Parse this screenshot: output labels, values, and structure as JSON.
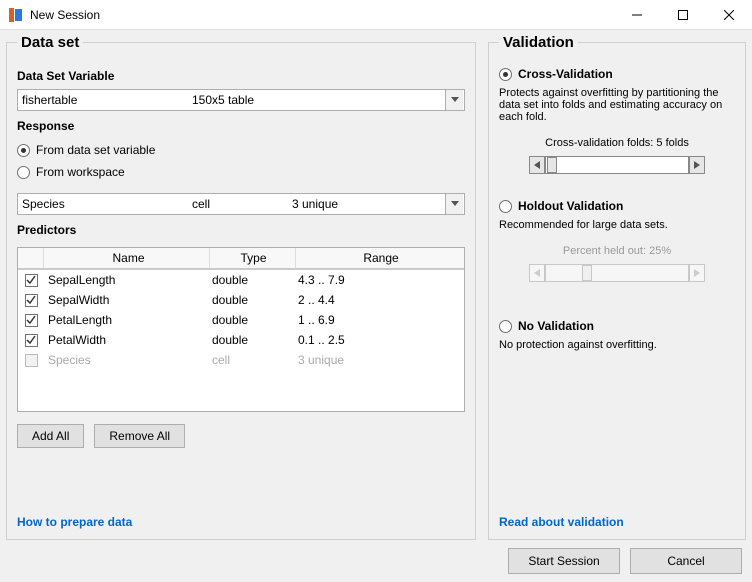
{
  "window": {
    "title": "New Session"
  },
  "dataset": {
    "legend": "Data set",
    "var_label": "Data Set Variable",
    "var_name": "fishertable",
    "var_size": "150x5 table",
    "response_label": "Response",
    "from_dataset": "From data set variable",
    "from_workspace": "From workspace",
    "resp_name": "Species",
    "resp_type": "cell",
    "resp_range": "3 unique",
    "predictors_label": "Predictors",
    "headers": {
      "name": "Name",
      "type": "Type",
      "range": "Range"
    },
    "rows": [
      {
        "checked": true,
        "name": "SepalLength",
        "type": "double",
        "range": "4.3 .. 7.9"
      },
      {
        "checked": true,
        "name": "SepalWidth",
        "type": "double",
        "range": "2 .. 4.4"
      },
      {
        "checked": true,
        "name": "PetalLength",
        "type": "double",
        "range": "1 .. 6.9"
      },
      {
        "checked": true,
        "name": "PetalWidth",
        "type": "double",
        "range": "0.1 .. 2.5"
      },
      {
        "checked": false,
        "name": "Species",
        "type": "cell",
        "range": "3 unique",
        "disabled": true
      }
    ],
    "add_all": "Add All",
    "remove_all": "Remove All",
    "prepare_link": "How to prepare data"
  },
  "validation": {
    "legend": "Validation",
    "cross": {
      "label": "Cross-Validation",
      "desc": "Protects against overfitting by partitioning the data set into folds and estimating accuracy on each fold.",
      "folds_label": "Cross-validation folds: 5 folds"
    },
    "holdout": {
      "label": "Holdout Validation",
      "desc": "Recommended for large data sets.",
      "percent_label": "Percent held out: 25%"
    },
    "none": {
      "label": "No Validation",
      "desc": "No protection against overfitting."
    },
    "read_link": "Read about validation"
  },
  "footer": {
    "start": "Start Session",
    "cancel": "Cancel"
  }
}
